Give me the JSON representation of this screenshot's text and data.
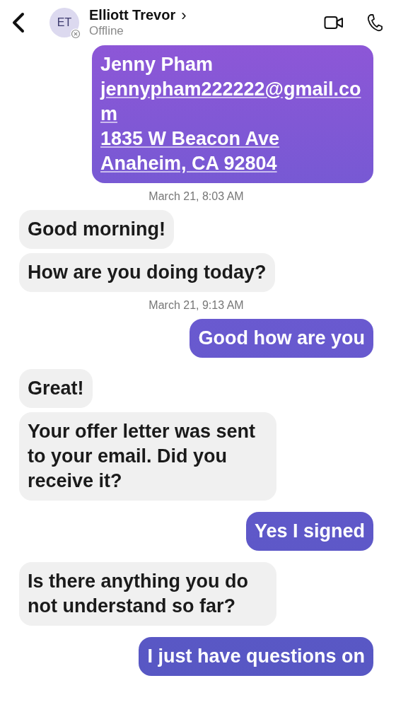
{
  "header": {
    "initials": "ET",
    "name": "Elliott Trevor",
    "chevron": "›",
    "status": "Offline",
    "offline": true
  },
  "messages": [
    {
      "kind": "sent",
      "lines": [
        {
          "text": "Jenny Pham",
          "link": false
        },
        {
          "text": "jennypham222222@gmail.com",
          "link": true
        },
        {
          "text": "1835 W Beacon Ave",
          "link": true
        },
        {
          "text": "Anaheim, CA 92804",
          "link": true
        }
      ]
    },
    {
      "kind": "timestamp",
      "text": "March 21, 8:03 AM"
    },
    {
      "kind": "received",
      "text": "Good morning!"
    },
    {
      "kind": "received",
      "text": "How are you doing today?"
    },
    {
      "kind": "timestamp",
      "text": "March 21, 9:13 AM"
    },
    {
      "kind": "sent",
      "text": "Good how are you"
    },
    {
      "kind": "received",
      "text": "Great!"
    },
    {
      "kind": "received",
      "text": "Your offer letter was sent to your email. Did you receive it?"
    },
    {
      "kind": "sent",
      "text": "Yes I signed"
    },
    {
      "kind": "received",
      "text": "Is there anything you do not understand so far?"
    },
    {
      "kind": "sent",
      "text": "I just have questions on"
    }
  ]
}
